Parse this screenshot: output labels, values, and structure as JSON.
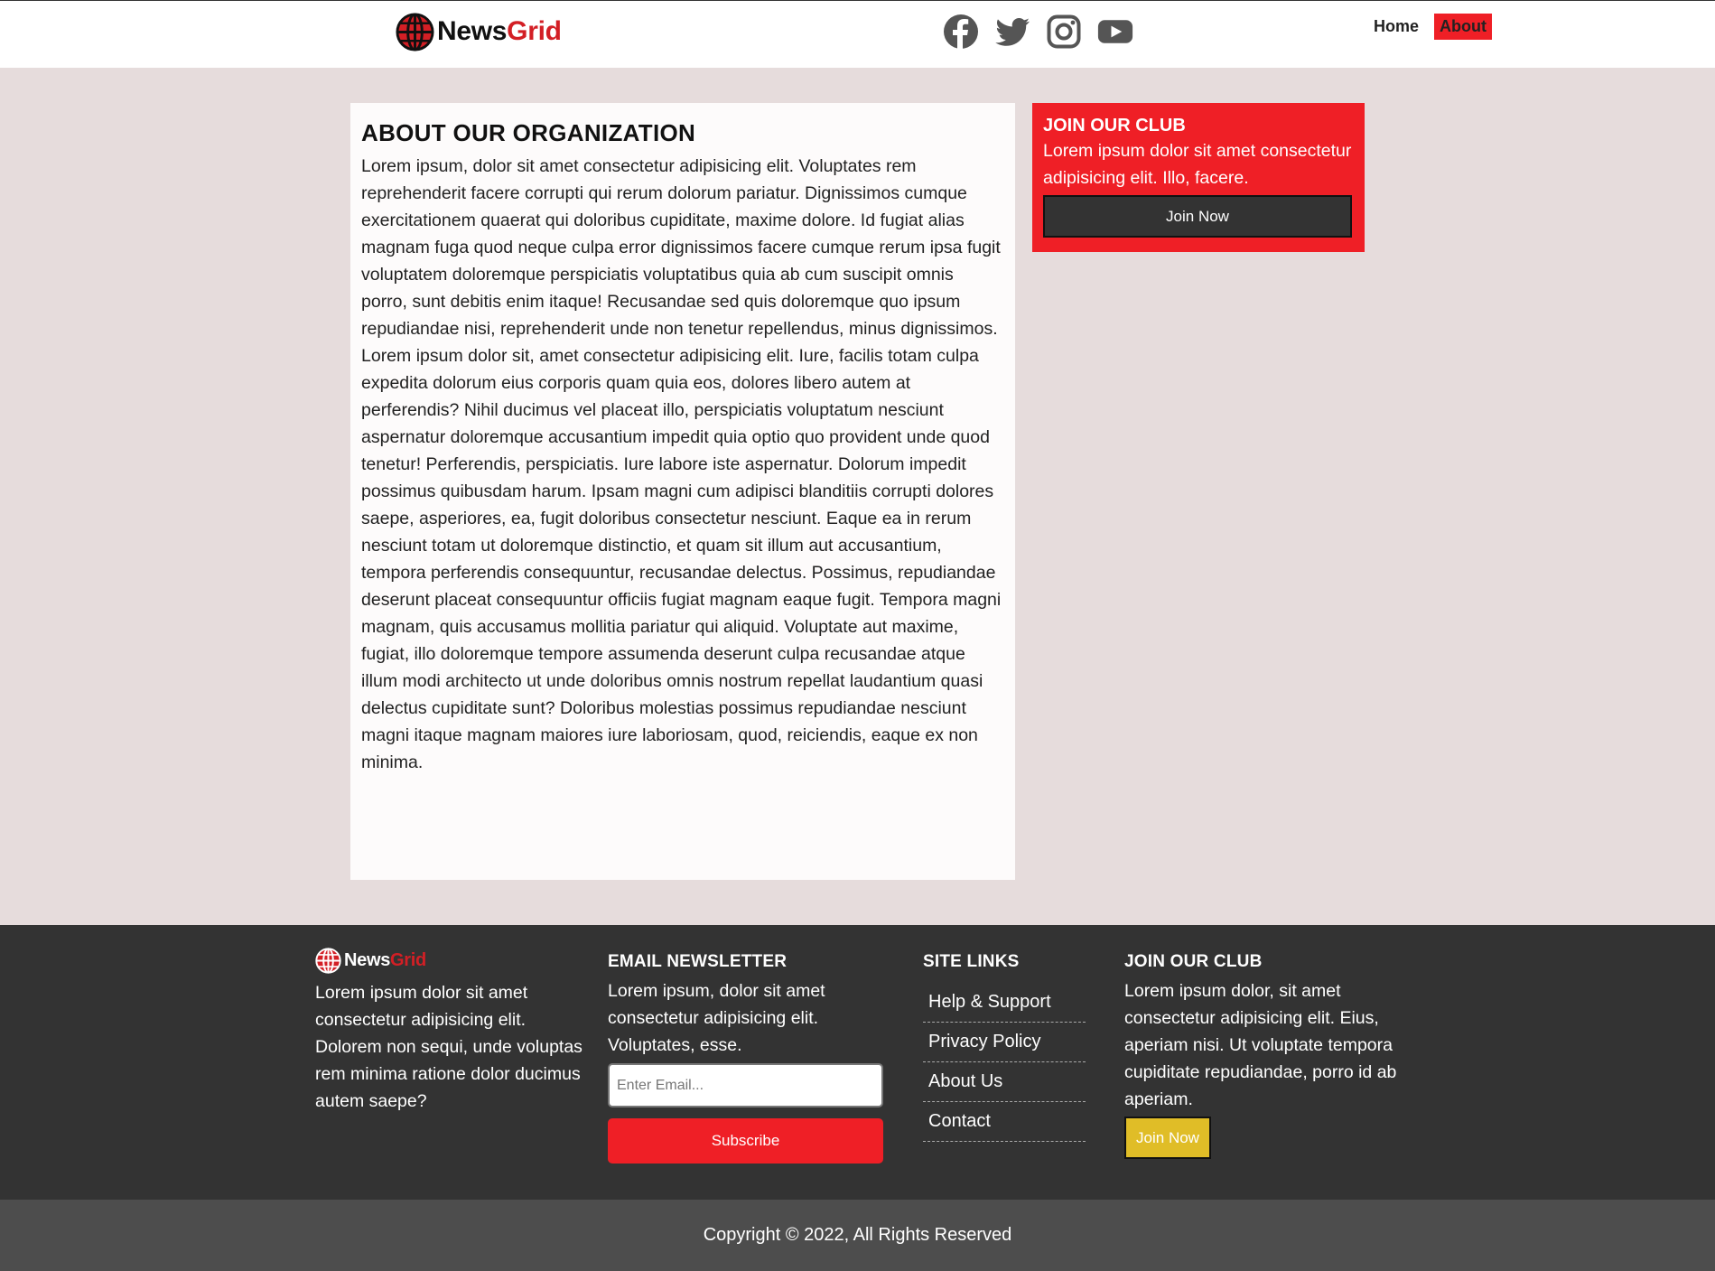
{
  "header": {
    "logo": {
      "part1": "News",
      "part2": "Grid"
    },
    "social": [
      {
        "name": "facebook-icon"
      },
      {
        "name": "twitter-icon"
      },
      {
        "name": "instagram-icon"
      },
      {
        "name": "youtube-icon"
      }
    ],
    "nav": [
      {
        "label": "Home",
        "active": false
      },
      {
        "label": "About",
        "active": true
      }
    ]
  },
  "main": {
    "title": "ABOUT OUR ORGANIZATION",
    "paragraphs": [
      "Lorem ipsum, dolor sit amet consectetur adipisicing elit. Voluptates rem reprehenderit facere corrupti qui rerum dolorum pariatur. Dignissimos cumque exercitationem quaerat qui doloribus cupiditate, maxime dolore. Id fugiat alias magnam fuga quod neque culpa error dignissimos facere cumque rerum ipsa fugit voluptatem doloremque perspiciatis voluptatibus quia ab cum suscipit omnis porro, sunt debitis enim itaque! Recusandae sed quis doloremque quo ipsum repudiandae nisi, reprehenderit unde non tenetur repellendus, minus dignissimos.",
      "Lorem ipsum dolor sit, amet consectetur adipisicing elit. Iure, facilis totam culpa expedita dolorum eius corporis quam quia eos, dolores libero autem at perferendis? Nihil ducimus vel placeat illo, perspiciatis voluptatum nesciunt aspernatur doloremque accusantium impedit quia optio quo provident unde quod tenetur! Perferendis, perspiciatis. Iure labore iste aspernatur. Dolorum impedit possimus quibusdam harum. Ipsam magni cum adipisci blanditiis corrupti dolores saepe, asperiores, ea, fugit doloribus consectetur nesciunt. Eaque ea in rerum nesciunt totam ut doloremque distinctio, et quam sit illum aut accusantium, tempora perferendis consequuntur, recusandae delectus. Possimus, repudiandae deserunt placeat consequuntur officiis fugiat magnam eaque fugit. Tempora magni magnam, quis accusamus mollitia pariatur qui aliquid. Voluptate aut maxime, fugiat, illo doloremque tempore assumenda deserunt culpa recusandae atque illum modi architecto ut unde doloribus omnis nostrum repellat laudantium quasi delectus cupiditate sunt? Doloribus molestias possimus repudiandae nesciunt magni itaque magnam maiores iure laboriosam, quod, reiciendis, eaque ex non minima."
    ]
  },
  "sidebar": {
    "title": "JOIN OUR CLUB",
    "text": "Lorem ipsum dolor sit amet consectetur adipisicing elit. Illo, facere.",
    "button": "Join Now"
  },
  "footer": {
    "about": {
      "logo": {
        "part1": "News",
        "part2": "Grid"
      },
      "text": "Lorem ipsum dolor sit amet consectetur adipisicing elit. Dolorem non sequi, unde voluptas rem minima ratione dolor ducimus autem saepe?"
    },
    "newsletter": {
      "title": "EMAIL NEWSLETTER",
      "text": "Lorem ipsum, dolor sit amet consectetur adipisicing elit. Voluptates, esse.",
      "placeholder": "Enter Email...",
      "button": "Subscribe"
    },
    "links": {
      "title": "SITE LINKS",
      "items": [
        "Help & Support",
        "Privacy Policy",
        "About Us",
        "Contact"
      ]
    },
    "club": {
      "title": "JOIN OUR CLUB",
      "text": "Lorem ipsum dolor, sit amet consectetur adipisicing elit. Eius, aperiam nisi. Ut voluptate tempora cupiditate repudiandae, porro id ab aperiam.",
      "button": "Join Now"
    },
    "copyright": "Copyright © 2022, All Rights Reserved"
  },
  "colors": {
    "accent": "#ef1f26",
    "footer_bg": "#333333",
    "page_bg": "#e6dcdc",
    "club_button": "#e0bd27"
  }
}
